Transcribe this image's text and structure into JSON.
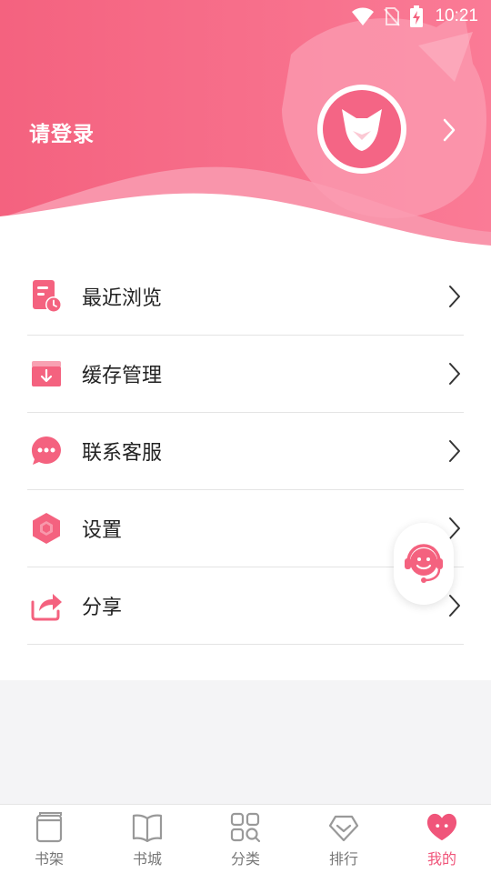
{
  "status_bar": {
    "time": "10:21",
    "wifi_icon": "wifi-icon",
    "sim_icon": "no-sim-icon",
    "battery_icon": "battery-charging-icon"
  },
  "header": {
    "login_text": "请登录",
    "avatar_icon": "fox-avatar-icon",
    "chevron_icon": "chevron-right-icon",
    "accent": "#f0557a"
  },
  "menu": {
    "items": [
      {
        "label": "最近浏览",
        "icon": "recent-history-icon"
      },
      {
        "label": "缓存管理",
        "icon": "cache-download-icon"
      },
      {
        "label": "联系客服",
        "icon": "chat-bubble-icon"
      },
      {
        "label": "设置",
        "icon": "settings-hexagon-icon"
      },
      {
        "label": "分享",
        "icon": "share-icon"
      }
    ]
  },
  "float_button": {
    "icon": "customer-service-icon"
  },
  "bottom_nav": {
    "items": [
      {
        "label": "书架",
        "icon": "bookshelf-icon",
        "active": false
      },
      {
        "label": "书城",
        "icon": "book-open-icon",
        "active": false
      },
      {
        "label": "分类",
        "icon": "category-grid-icon",
        "active": false
      },
      {
        "label": "排行",
        "icon": "ranking-diamond-icon",
        "active": false
      },
      {
        "label": "我的",
        "icon": "profile-heart-icon",
        "active": true
      }
    ]
  }
}
